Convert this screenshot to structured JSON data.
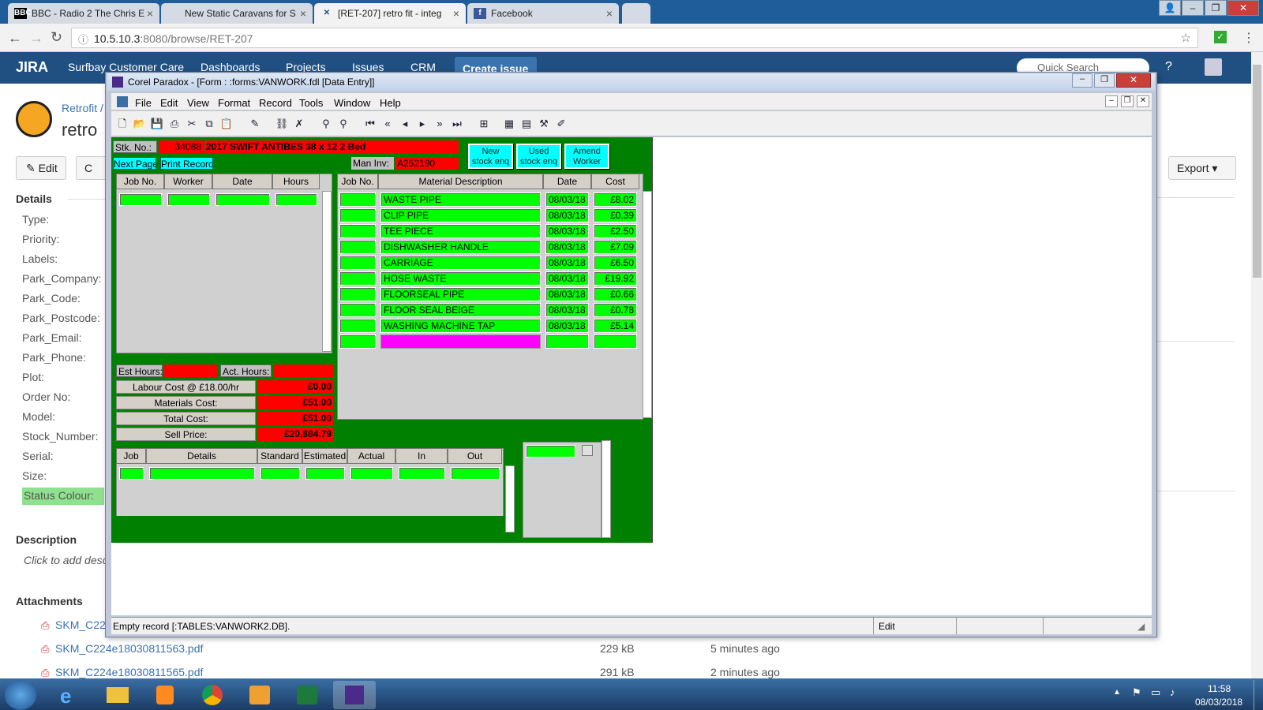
{
  "browser": {
    "tabs": [
      {
        "label": "BBC - Radio 2 The Chris E",
        "icon": "BBC"
      },
      {
        "label": "New Static Caravans for S",
        "icon": ""
      },
      {
        "label": "[RET-207] retro fit - integ",
        "icon": "jira"
      },
      {
        "label": "Facebook",
        "icon": "f"
      }
    ],
    "url_host": "10.5.10.3",
    "url_path": ":8080/browse/RET-207"
  },
  "jira": {
    "logo": "JIRA",
    "site": "Surfbay Customer Care",
    "nav": [
      "Dashboards",
      "Projects",
      "Issues",
      "CRM"
    ],
    "create": "Create issue",
    "search_placeholder": "Quick Search",
    "breadcrumb": "Retrofit /",
    "title": "retro",
    "edit": "Edit",
    "comment": "C",
    "export": "Export",
    "details_heading": "Details",
    "fields": [
      "Type:",
      "Priority:",
      "Labels:",
      "Park_Company:",
      "Park_Code:",
      "Park_Postcode:",
      "Park_Email:",
      "Park_Phone:",
      "Plot:",
      "Order No:",
      "Model:",
      "Stock_Number:",
      "Serial:",
      "Size:",
      "Status Colour:"
    ],
    "description_heading": "Description",
    "description_placeholder": "Click to add desc",
    "attachments_heading": "Attachments",
    "attachments": [
      {
        "name": "SKM_C22",
        "size": "",
        "time": ""
      },
      {
        "name": "SKM_C224e18030811563.pdf",
        "size": "229 kB",
        "time": "5 minutes ago"
      },
      {
        "name": "SKM_C224e18030811565.pdf",
        "size": "291 kB",
        "time": "2 minutes ago"
      }
    ]
  },
  "paradox": {
    "title": "Corel Paradox - [Form : :forms:VANWORK.fdl [Data Entry]]",
    "menu": [
      "File",
      "Edit",
      "View",
      "Format",
      "Record",
      "Tools",
      "Window",
      "Help"
    ],
    "stk_label": "Stk. No.:",
    "stk_no": "34088",
    "stk_desc": "2017 SWIFT ANTIBES 38 x 12 2 Bed",
    "next_page": "Next Page",
    "print_record": "Print Record",
    "man_inv_label": "Man Inv:",
    "man_inv": "A252190",
    "btn_new": [
      "New",
      "stock enq"
    ],
    "btn_used": [
      "Used",
      "stock enq"
    ],
    "btn_amend": [
      "Amend",
      "Worker"
    ],
    "labour_headers": [
      "Job No.",
      "Worker",
      "Date",
      "Hours"
    ],
    "material_headers": [
      "Job No.",
      "Material Description",
      "Date",
      "Cost"
    ],
    "materials": [
      {
        "desc": "WASTE PIPE",
        "date": "08/03/18",
        "cost": "£8.02"
      },
      {
        "desc": "CLIP PIPE",
        "date": "08/03/18",
        "cost": "£0.39"
      },
      {
        "desc": "TEE PIECE",
        "date": "08/03/18",
        "cost": "£2.50"
      },
      {
        "desc": "DISHWASHER HANDLE",
        "date": "08/03/18",
        "cost": "£7.09"
      },
      {
        "desc": "CARRIAGE",
        "date": "08/03/18",
        "cost": "£6.50"
      },
      {
        "desc": "HOSE WASTE",
        "date": "08/03/18",
        "cost": "£19.92"
      },
      {
        "desc": "FLOORSEAL PIPE",
        "date": "08/03/18",
        "cost": "£0.66"
      },
      {
        "desc": "FLOOR SEAL BEIGE",
        "date": "08/03/18",
        "cost": "£0.78"
      },
      {
        "desc": "WASHING MACHINE TAP",
        "date": "08/03/18",
        "cost": "£5.14"
      }
    ],
    "est_hours_label": "Est Hours:",
    "act_hours_label": "Act. Hours:",
    "labour_cost_label": "Labour Cost @ £18.00/hr",
    "labour_cost": "£0.00",
    "materials_cost_label": "Materials Cost:",
    "materials_cost": "£51.00",
    "total_cost_label": "Total Cost:",
    "total_cost": "£51.00",
    "sell_price_label": "Sell Price:",
    "sell_price": "£20,884.79",
    "job_headers": [
      "Job",
      "Details",
      "Standard",
      "Estimated",
      "Actual",
      "In",
      "Out"
    ],
    "status_message": "Empty record [:TABLES:VANWORK2.DB].",
    "status_mode": "Edit"
  },
  "taskbar": {
    "time": "11:58",
    "date": "08/03/2018"
  },
  "colors": {
    "form_bg": "#008000",
    "field_green": "#00ff00",
    "field_red": "#ff0000",
    "button_cyan": "#00ffff",
    "jira_blue": "#205081"
  }
}
